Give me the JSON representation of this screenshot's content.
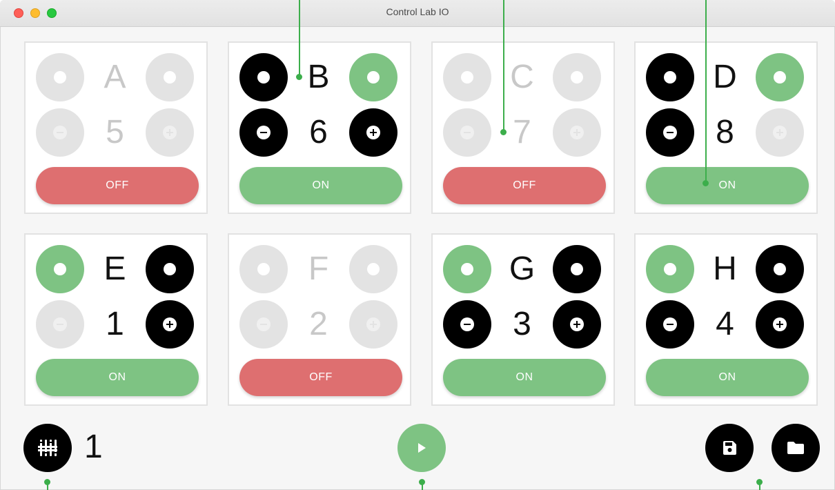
{
  "window": {
    "title": "Control Lab IO"
  },
  "channels": [
    {
      "letter": "A",
      "value": "5",
      "state_label": "OFF"
    },
    {
      "letter": "B",
      "value": "6",
      "state_label": "ON"
    },
    {
      "letter": "C",
      "value": "7",
      "state_label": "OFF"
    },
    {
      "letter": "D",
      "value": "8",
      "state_label": "ON"
    },
    {
      "letter": "E",
      "value": "1",
      "state_label": "ON"
    },
    {
      "letter": "F",
      "value": "2",
      "state_label": "OFF"
    },
    {
      "letter": "G",
      "value": "3",
      "state_label": "ON"
    },
    {
      "letter": "H",
      "value": "4",
      "state_label": "ON"
    }
  ],
  "footer": {
    "selected_channel": "1"
  },
  "icons": {
    "mixer": "sliders-icon",
    "play": "play-icon",
    "save": "save-disk-icon",
    "open": "folder-icon"
  },
  "colors": {
    "on": "#7ec383",
    "off": "#de6f70",
    "active": "#000000",
    "inactive": "#e3e3e3",
    "annotation": "#3cae4b"
  }
}
